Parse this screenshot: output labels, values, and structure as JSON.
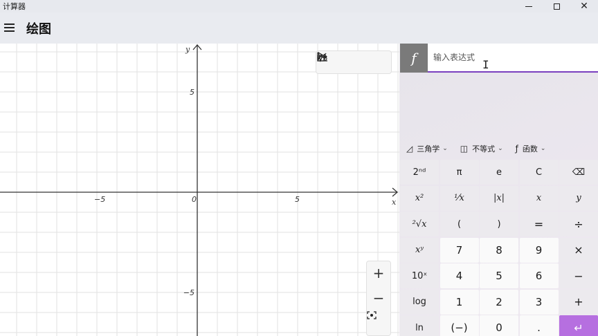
{
  "window": {
    "title": "计算器",
    "minimize_glyph": "—",
    "maximize_glyph": "☐",
    "close_glyph": "✕"
  },
  "header": {
    "mode_title": "绘图",
    "menu_icon": "hamburger-icon"
  },
  "graph": {
    "x_label": "x",
    "y_label": "y",
    "x_ticks": [
      "−5",
      "0",
      "5"
    ],
    "y_ticks": [
      "5",
      "−5"
    ],
    "x_tick_values": [
      -5,
      0,
      5
    ],
    "y_tick_values": [
      5,
      -5
    ],
    "toolbar": [
      {
        "name": "select-pointer-icon",
        "glyph": "⇱"
      },
      {
        "name": "share-icon",
        "glyph": "⤴"
      },
      {
        "name": "graph-settings-icon",
        "glyph": "⚙"
      }
    ],
    "zoom": {
      "zoom_in": "+",
      "zoom_out": "−",
      "fit": "▣"
    }
  },
  "expression_panel": {
    "fx_label": "f",
    "input_placeholder": "输入表达式",
    "input_value": ""
  },
  "function_menu": [
    {
      "icon": "◿",
      "label": "三角学"
    },
    {
      "icon": "◫",
      "label": "不等式"
    },
    {
      "icon": "ƒ",
      "label": "函数"
    }
  ],
  "keypad": {
    "row1": [
      "2ⁿᵈ",
      "π",
      "e",
      "C",
      "⌫"
    ],
    "row2": [
      "x²",
      "¹⁄x",
      "|x|",
      "x",
      "y"
    ],
    "row3": [
      "²√x",
      "(",
      ")",
      "=",
      "÷"
    ],
    "row4": [
      "xʸ",
      "7",
      "8",
      "9",
      "×"
    ],
    "row5": [
      "10ˣ",
      "4",
      "5",
      "6",
      "−"
    ],
    "row6": [
      "log",
      "1",
      "2",
      "3",
      "+"
    ],
    "row7": [
      "ln",
      "(−)",
      "0",
      ".",
      "↵"
    ]
  },
  "colors": {
    "accent": "#7a3fbf",
    "equals_key": "#b66fe0",
    "fx_box": "#7a7a7a"
  }
}
